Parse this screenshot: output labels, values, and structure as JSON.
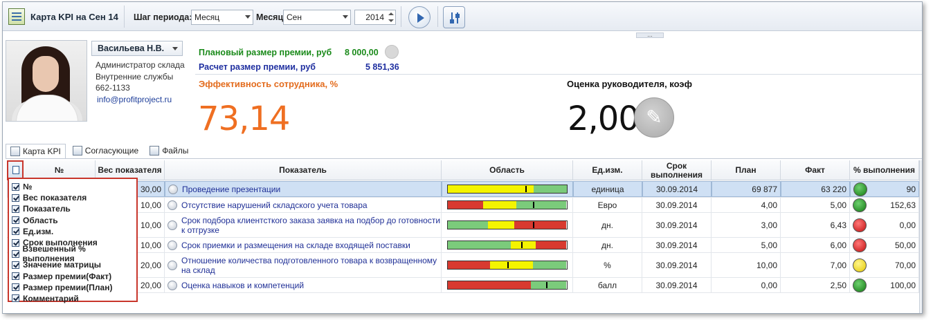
{
  "toolbar": {
    "title": "Карта KPI на Сен 14",
    "period_step_label": "Шаг периода:",
    "period_step_value": "Месяц",
    "month_label": "Месяц",
    "month_value": "Сен",
    "year_value": "2014",
    "play_icon": "play-icon",
    "settings_icon": "sliders-icon"
  },
  "profile": {
    "name": "Васильева Н.В.",
    "position": "Администратор склада",
    "department": "Внутренние службы",
    "phone": "662-1133",
    "email": "info@profitproject.ru"
  },
  "bonus": {
    "planned_label": "Плановый размер премии, руб",
    "planned_value": "8 000,00",
    "calc_label": "Расчет размер премии, руб",
    "calc_value": "5 851,36"
  },
  "efficiency": {
    "label": "Эффективность сотрудника, %",
    "value": "73,14"
  },
  "manager": {
    "label": "Оценка руководителя, коэф",
    "value": "2,00"
  },
  "tabs": [
    "Карта KPI",
    "Согласующие",
    "Файлы"
  ],
  "grid": {
    "headers": {
      "num": "№",
      "weight": "Вес показателя",
      "kpi": "Показатель",
      "area": "Область",
      "unit": "Ед.изм.",
      "deadline": "Срок выполнения",
      "plan": "План",
      "fact": "Факт",
      "pct": "% выполнения"
    },
    "rows": [
      {
        "weight": "30,00",
        "kpi": "Проведение презентации",
        "unit": "единица",
        "deadline": "30.09.2014",
        "plan": "69 877",
        "fact": "63 220",
        "status": "green",
        "pct": "90",
        "area": [
          [
            "yellow",
            0.72
          ],
          [
            "green",
            0.28
          ]
        ],
        "marker": 0.65
      },
      {
        "weight": "10,00",
        "kpi": "Отсутствие нарушений складского учета товара",
        "unit": "Евро",
        "deadline": "30.09.2014",
        "plan": "4,00",
        "fact": "5,00",
        "status": "green",
        "pct": "152,63",
        "area": [
          [
            "red",
            0.3
          ],
          [
            "yellow",
            0.28
          ],
          [
            "green",
            0.42
          ]
        ],
        "marker": 0.72
      },
      {
        "weight": "10,00",
        "kpi": "Срок подбора клиентсткого заказа заявка на подбор до готовности к отгрузке",
        "unit": "дн.",
        "deadline": "30.09.2014",
        "plan": "3,00",
        "fact": "6,43",
        "status": "red",
        "pct": "0,00",
        "area": [
          [
            "green",
            0.34
          ],
          [
            "yellow",
            0.22
          ],
          [
            "red",
            0.44
          ]
        ],
        "marker": 0.72
      },
      {
        "weight": "10,00",
        "kpi": "Срок приемки и размещения на складе входящей поставки",
        "unit": "дн.",
        "deadline": "30.09.2014",
        "plan": "5,00",
        "fact": "6,00",
        "status": "red",
        "pct": "50,00",
        "area": [
          [
            "green",
            0.53
          ],
          [
            "yellow",
            0.21
          ],
          [
            "red",
            0.26
          ]
        ],
        "marker": 0.62
      },
      {
        "weight": "20,00",
        "kpi": "Отношение количества подготовленного товара к возвращенному на склад",
        "unit": "%",
        "deadline": "30.09.2014",
        "plan": "10,00",
        "fact": "7,00",
        "status": "yellow",
        "pct": "70,00",
        "area": [
          [
            "red",
            0.36
          ],
          [
            "yellow",
            0.36
          ],
          [
            "green",
            0.28
          ]
        ],
        "marker": 0.5
      },
      {
        "weight": "20,00",
        "kpi": "Оценка навыков и компетенций",
        "unit": "балл",
        "deadline": "30.09.2014",
        "plan": "0,00",
        "fact": "2,50",
        "status": "green",
        "pct": "100,00",
        "area": [
          [
            "red",
            0.7
          ],
          [
            "green",
            0.3
          ]
        ],
        "marker": 0.83
      }
    ]
  },
  "column_chooser": [
    "№",
    "Вес показателя",
    "Показатель",
    "Область",
    "Ед.изм.",
    "Срок выполнения",
    "Взвешенный % выполнения",
    "Значение матрицы",
    "Размер премии(Факт)",
    "Размер премии(План)",
    "Комментарий"
  ],
  "colors": {
    "red": "#d83a30",
    "yellow": "#f4f400",
    "green": "#7bcb7b",
    "efficiency": "#ef6f22",
    "planned": "#1a8a1a",
    "calc": "#1f2fa0"
  }
}
